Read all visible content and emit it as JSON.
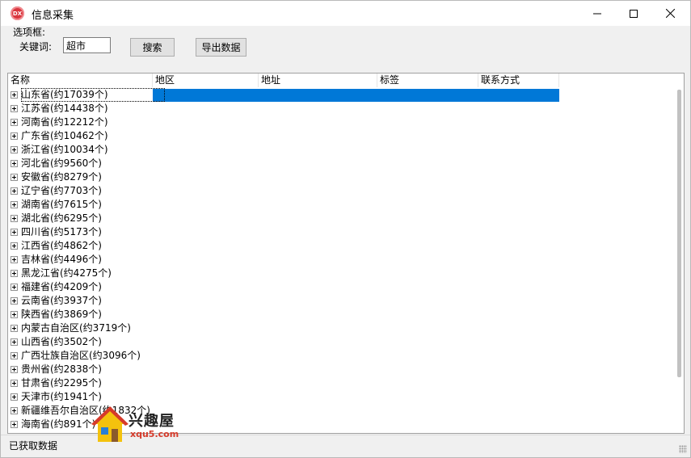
{
  "window": {
    "icon_text": "DX",
    "title": "信息采集"
  },
  "options": {
    "group_label": "选项框:",
    "keyword_label": "关键词:",
    "keyword_value": "超市",
    "search_label": "搜索",
    "export_label": "导出数据"
  },
  "list": {
    "columns": [
      "名称",
      "地区",
      "地址",
      "标签",
      "联系方式"
    ],
    "rows": [
      "山东省(约17039个)",
      "江苏省(约14438个)",
      "河南省(约12212个)",
      "广东省(约10462个)",
      "浙江省(约10034个)",
      "河北省(约9560个)",
      "安徽省(约8279个)",
      "辽宁省(约7703个)",
      "湖南省(约7615个)",
      "湖北省(约6295个)",
      "四川省(约5173个)",
      "江西省(约4862个)",
      "吉林省(约4496个)",
      "黑龙江省(约4275个)",
      "福建省(约4209个)",
      "云南省(约3937个)",
      "陕西省(约3869个)",
      "内蒙古自治区(约3719个)",
      "山西省(约3502个)",
      "广西壮族自治区(约3096个)",
      "贵州省(约2838个)",
      "甘肃省(约2295个)",
      "天津市(约1941个)",
      "新疆维吾尔自治区(约1832个)",
      "海南省(约891个)"
    ]
  },
  "status": {
    "text": "已获取数据"
  },
  "watermark": {
    "name": "兴趣屋",
    "url": "xqu5.com"
  },
  "colors": {
    "selection": "#0078d7",
    "app_icon": "#d9363e"
  }
}
